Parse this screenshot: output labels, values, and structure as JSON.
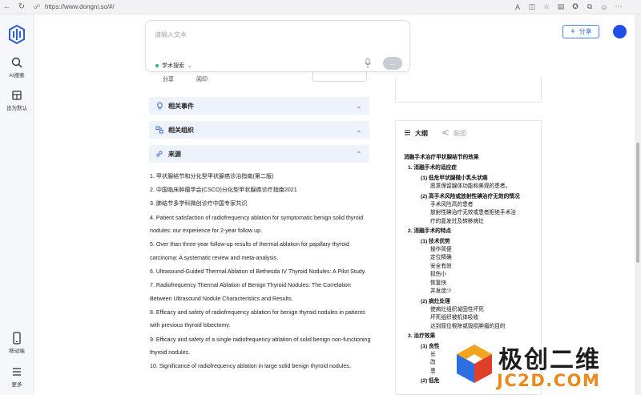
{
  "browser": {
    "url": "https://www.dongni.so/#/"
  },
  "sidebar": {
    "items": [
      {
        "label": "AI搜索",
        "icon": "search-icon"
      },
      {
        "label": "设为默认",
        "icon": "pin-icon"
      },
      {
        "label": "移动端",
        "icon": "phone-icon"
      },
      {
        "label": "更多",
        "icon": "menu-icon"
      }
    ]
  },
  "header": {
    "share_label": "分享"
  },
  "search": {
    "placeholder": "请输入文本",
    "mode_label": "学术搜索"
  },
  "partial_row": {
    "share": "分享",
    "print": "阅印",
    "dots": "…"
  },
  "accordions": [
    {
      "label": "相关事件",
      "icon": "lightbulb-icon",
      "expanded": false
    },
    {
      "label": "相关组织",
      "icon": "org-icon",
      "expanded": false
    },
    {
      "label": "来源",
      "icon": "link-icon",
      "expanded": true
    }
  ],
  "sources": [
    "1. 甲状腺结节和分化型甲状腺癌诊治指南(第二版)",
    "2. 中国临床肿瘤学会(CSCO)分化型甲状腺癌诊疗指南2021",
    "3. 肺结节多学科微创诊疗中国专家共识",
    "4. Patient satisfaction of radiofrequency ablation for symptomatic benign solid thyroid nodules: our experience for 2-year follow up.",
    "5. Over than three-year follow-up results of thermal ablation for papillary thyroid carcinoma: A systematic review and meta-analysis.",
    "6. Ultrasound-Guided Thermal Ablation of Bethesda IV Thyroid Nodules: A Pilot Study.",
    "7. Radiofrequency Thermal Ablation of Benign Thyroid Nodules: The Correlation Between Ultrasound Nodule Characteristics and Results.",
    "8. Efficacy and safety of radiofrequency ablation for benign thyroid nodules in patients with previous thyroid lobectomy.",
    "9. Efficacy and safety of a single radiofrequency ablation of solid benign non-functioning thyroid nodules.",
    "10. Significance of radiofrequency ablation in large solid benign thyroid nodules."
  ],
  "outline": {
    "tab_outline": "大纲",
    "tab_mindmap": "脑图",
    "lines": [
      {
        "level": "h0",
        "text": "消融手术治疗甲状腺结节的效果"
      },
      {
        "level": "h1",
        "text": "1. 消融手术的适应症"
      },
      {
        "level": "h2",
        "text": "(1) 低危甲状腺微小乳头状癌"
      },
      {
        "level": "h3",
        "text": "愿意保留腺体功能和美观的患者。"
      },
      {
        "level": "h2",
        "text": "(2) 高手术风险或放射性碘治疗无效的情况"
      },
      {
        "level": "h3",
        "text": "手术风险高的患者"
      },
      {
        "level": "h3",
        "text": "放射性碘治疗无效或患者拒绝手术治"
      },
      {
        "level": "h3",
        "text": "疗的复发灶及转移病灶"
      },
      {
        "level": "h1",
        "text": "2. 消融手术的特点"
      },
      {
        "level": "h2",
        "text": "(1) 技术优势"
      },
      {
        "level": "h3",
        "text": "操作简便"
      },
      {
        "level": "h3",
        "text": "定位精确"
      },
      {
        "level": "h3",
        "text": "安全有效"
      },
      {
        "level": "h3",
        "text": "损伤小"
      },
      {
        "level": "h3",
        "text": "恢复快"
      },
      {
        "level": "h3",
        "text": "并发症少"
      },
      {
        "level": "h2",
        "text": "(2) 病灶处理"
      },
      {
        "level": "h3",
        "text": "使病灶组织凝固性坏死"
      },
      {
        "level": "h3",
        "text": "坏死组织被机体吸收"
      },
      {
        "level": "h3",
        "text": "达到原位根除或毁损肿瘤的目的"
      },
      {
        "level": "h1",
        "text": "3. 治疗效果"
      },
      {
        "level": "h2",
        "text": "(1) 良性"
      },
      {
        "level": "h3",
        "text": "长"
      },
      {
        "level": "h3",
        "text": "改"
      },
      {
        "level": "h3",
        "text": "患"
      },
      {
        "level": "h2",
        "text": "(2) 低危"
      }
    ]
  },
  "watermark": {
    "title": "极创二维",
    "site": "JC2D.COM"
  }
}
